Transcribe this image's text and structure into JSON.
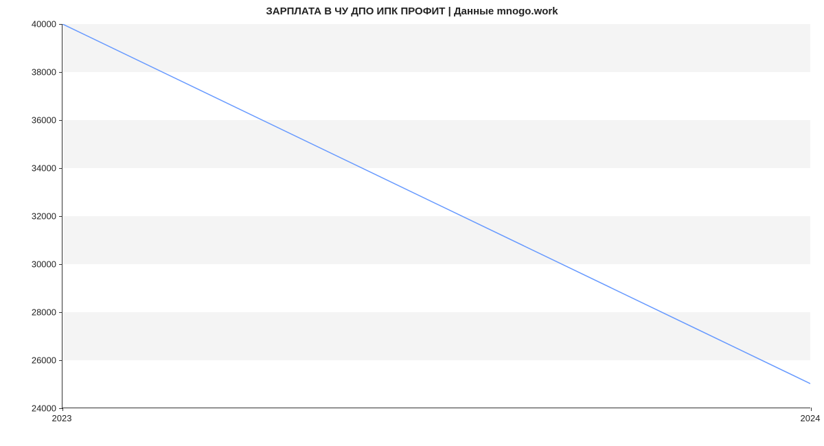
{
  "chart_data": {
    "type": "line",
    "title": "ЗАРПЛАТА В ЧУ ДПО ИПК ПРОФИТ | Данные mnogo.work",
    "xlabel": "",
    "ylabel": "",
    "x_categories": [
      "2023",
      "2024"
    ],
    "y_ticks": [
      24000,
      26000,
      28000,
      30000,
      32000,
      34000,
      36000,
      38000,
      40000
    ],
    "ylim": [
      24000,
      40000
    ],
    "series": [
      {
        "name": "salary",
        "x": [
          "2023",
          "2024"
        ],
        "values": [
          40000,
          25000
        ],
        "color": "#6699ff"
      }
    ]
  }
}
